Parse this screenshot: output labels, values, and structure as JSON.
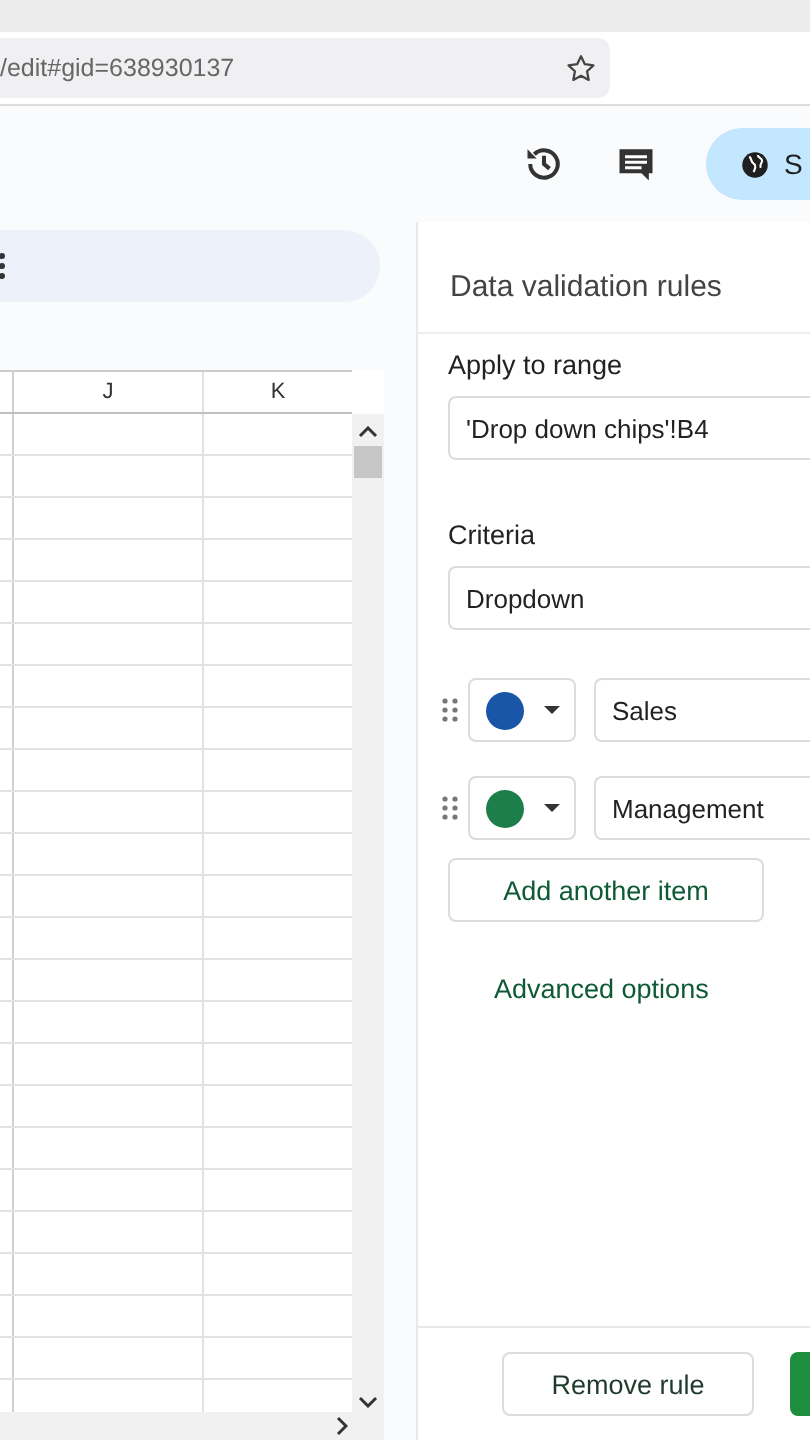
{
  "browser": {
    "url": "/edit#gid=638930137"
  },
  "toolbar": {
    "share_label": "S"
  },
  "sheet": {
    "columns": [
      "J",
      "K"
    ]
  },
  "panel": {
    "title": "Data validation rules",
    "range_label": "Apply to range",
    "range_value": "'Drop down chips'!B4",
    "criteria_label": "Criteria",
    "criteria_value": "Dropdown",
    "items": [
      {
        "color": "#1a56a8",
        "value": "Sales"
      },
      {
        "color": "#1e7e4a",
        "value": "Management"
      }
    ],
    "add_item": "Add another item",
    "advanced": "Advanced options",
    "remove": "Remove rule"
  }
}
